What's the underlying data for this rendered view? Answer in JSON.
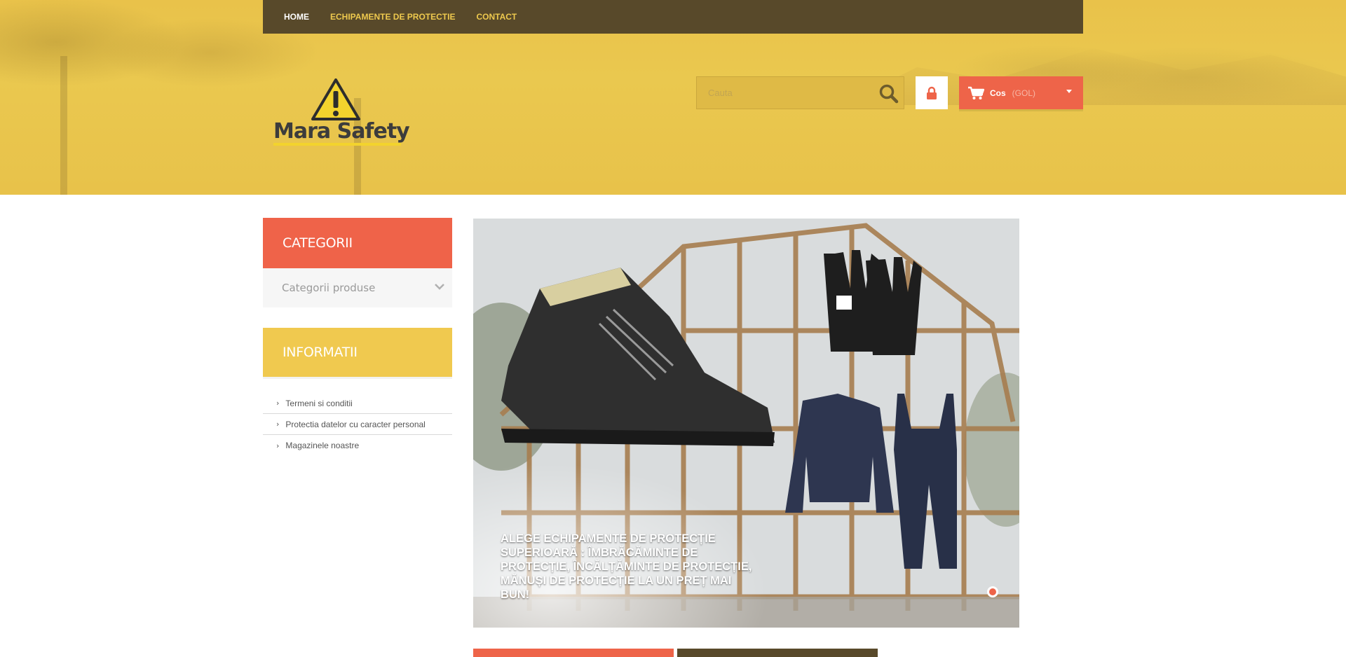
{
  "nav": {
    "items": [
      {
        "label": "HOME",
        "active": true
      },
      {
        "label": "ECHIPAMENTE DE PROTECTIE",
        "active": false
      },
      {
        "label": "CONTACT",
        "active": false
      }
    ]
  },
  "logo": {
    "text": "Mara Safety"
  },
  "search": {
    "placeholder": "Cauta",
    "value": ""
  },
  "cart": {
    "label": "Cos",
    "status": "(GOL)"
  },
  "sidebar": {
    "categories_title": "CATEGORII",
    "categories_select": "Categorii produse",
    "info_title": "INFORMATII",
    "info_links": [
      {
        "label": "Termeni si conditii"
      },
      {
        "label": "Protectia datelor cu caracter personal"
      },
      {
        "label": "Magazinele noastre"
      }
    ]
  },
  "slider": {
    "caption": "ALEGE ECHIPAMENTE DE PROTECȚIE SUPERIOARĂ : ÎMBRĂCĂMINTE DE PROTECȚIE, ÎNCĂLȚĂMINTE DE PROTECȚIE, MĂNUȘI DE PROTECȚIE LA UN PREȚ MAI BUN!"
  },
  "colors": {
    "nav_bg": "#58492a",
    "nav_link": "#eec94e",
    "accent_red": "#ee6449",
    "accent_yellow": "#f0c94f",
    "header_bg": "#e9c24a"
  },
  "icons": {
    "search": "search-icon",
    "lock": "lock-icon",
    "cart": "cart-icon",
    "chevron": "chevron-down-icon",
    "arrow": "chevron-right-icon",
    "logo": "warning-sign-icon"
  }
}
